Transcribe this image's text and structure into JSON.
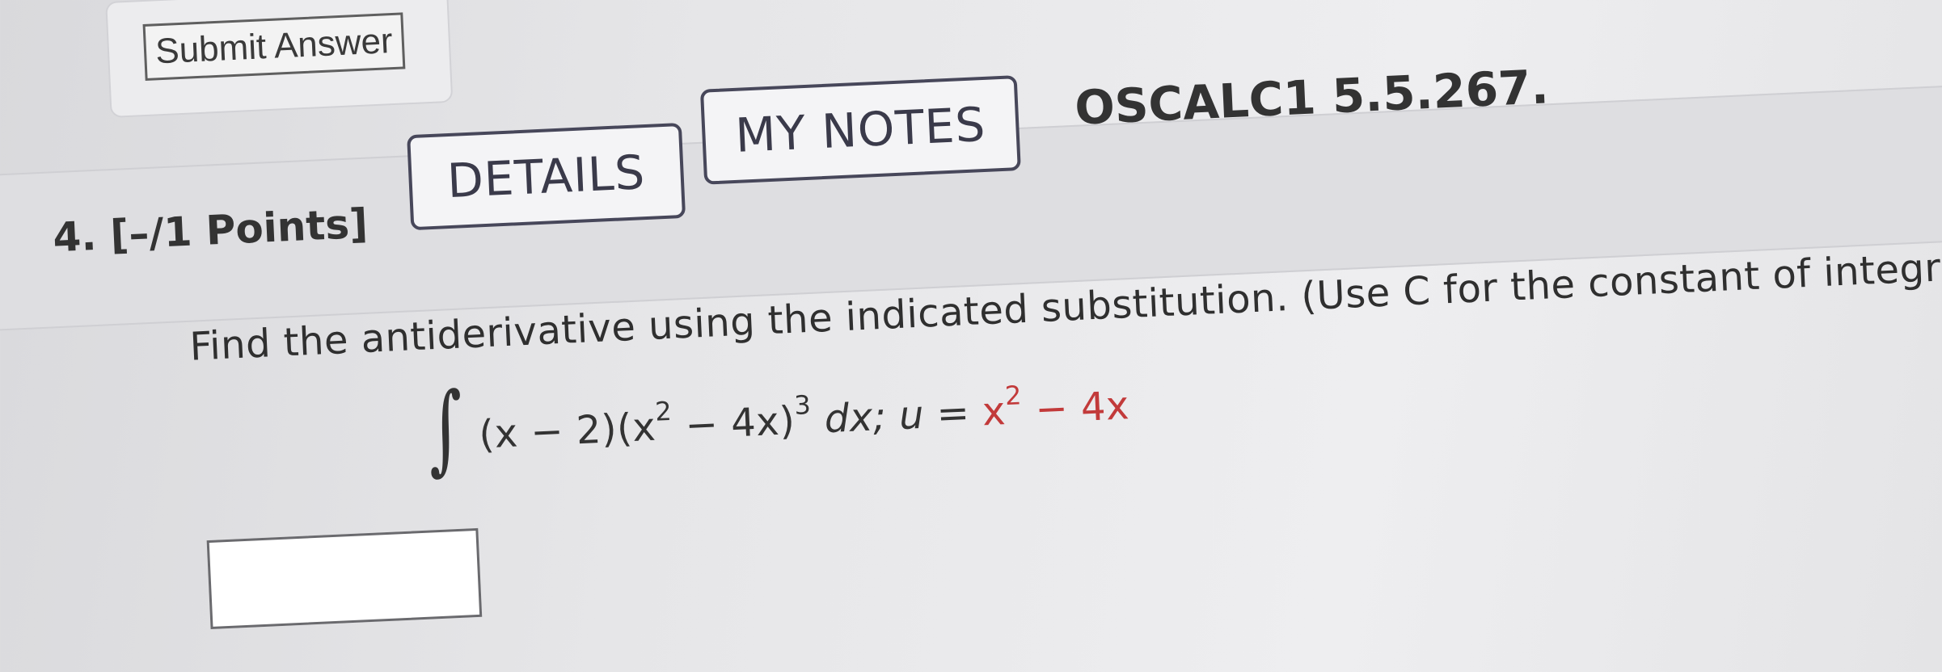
{
  "previous": {
    "submit_label": "Submit Answer"
  },
  "question": {
    "number_points": "4.  [–/1 Points]",
    "details_label": "DETAILS",
    "notes_label": "MY NOTES",
    "code": "OSCALC1 5.5.267.",
    "instructions": "Find the antiderivative using the indicated substitution. (Use C for the constant of integration.)",
    "integral_sign": "∫",
    "expr_open": "(x − 2)(x",
    "expr_sup1": "2",
    "expr_mid": " − 4x)",
    "expr_sup2": "3",
    "expr_dx": " dx; ",
    "expr_u": "u",
    "expr_eq": " = ",
    "expr_x": "x",
    "expr_sup3": "2",
    "expr_end": " − 4x",
    "answer_value": ""
  },
  "colors": {
    "highlight_red": "#c23a3a",
    "pill_border": "#47475a"
  }
}
